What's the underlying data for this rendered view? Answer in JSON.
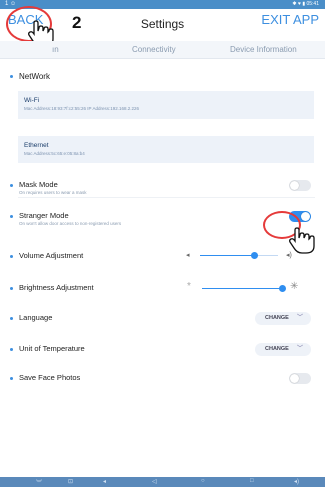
{
  "status_bar": {
    "left": "1 ☺",
    "right": "✱ ♥ ▮ 05:41"
  },
  "header": {
    "back_label": "BACK",
    "title": "Settings",
    "exit_label": "EXIT APP",
    "step_number": "2"
  },
  "tabs": [
    {
      "label": "ın"
    },
    {
      "label": "Connectivity"
    },
    {
      "label": "Device Information"
    }
  ],
  "network": {
    "heading": "NetWork",
    "wifi": {
      "title": "Wi-Fi",
      "sub": "Mac Address:18:93:7f:c2:55:26   IP Address:192.168.2.226"
    },
    "ethernet": {
      "title": "Ethernet",
      "sub": "Mac Address:5c:65:e:05:8a:b4"
    }
  },
  "settings": {
    "mask_mode": {
      "label": "Mask Mode",
      "sub": "On requires users to wear a mask",
      "on": false
    },
    "stranger_mode": {
      "label": "Stranger Mode",
      "sub": "On won't allow door access to non-registered users",
      "on": true
    },
    "volume": {
      "label": "Volume Adjustment",
      "level": 0.7
    },
    "brightness": {
      "label": "Brightness Adjustment",
      "level": 1.0
    },
    "language": {
      "label": "Language",
      "button": "CHANGE"
    },
    "temperature": {
      "label": "Unit of Temperature",
      "button": "CHANGE"
    },
    "face_photos": {
      "label": "Save Face Photos",
      "on": false
    }
  },
  "icons": {
    "volume_low": "volume-low-icon",
    "volume_high": "volume-high-icon",
    "brightness_low": "brightness-low-icon",
    "brightness_high": "brightness-high-icon"
  },
  "colors": {
    "accent": "#2f8ef0",
    "status_bar": "#4a8ec8",
    "highlight": "#e53a3a"
  }
}
